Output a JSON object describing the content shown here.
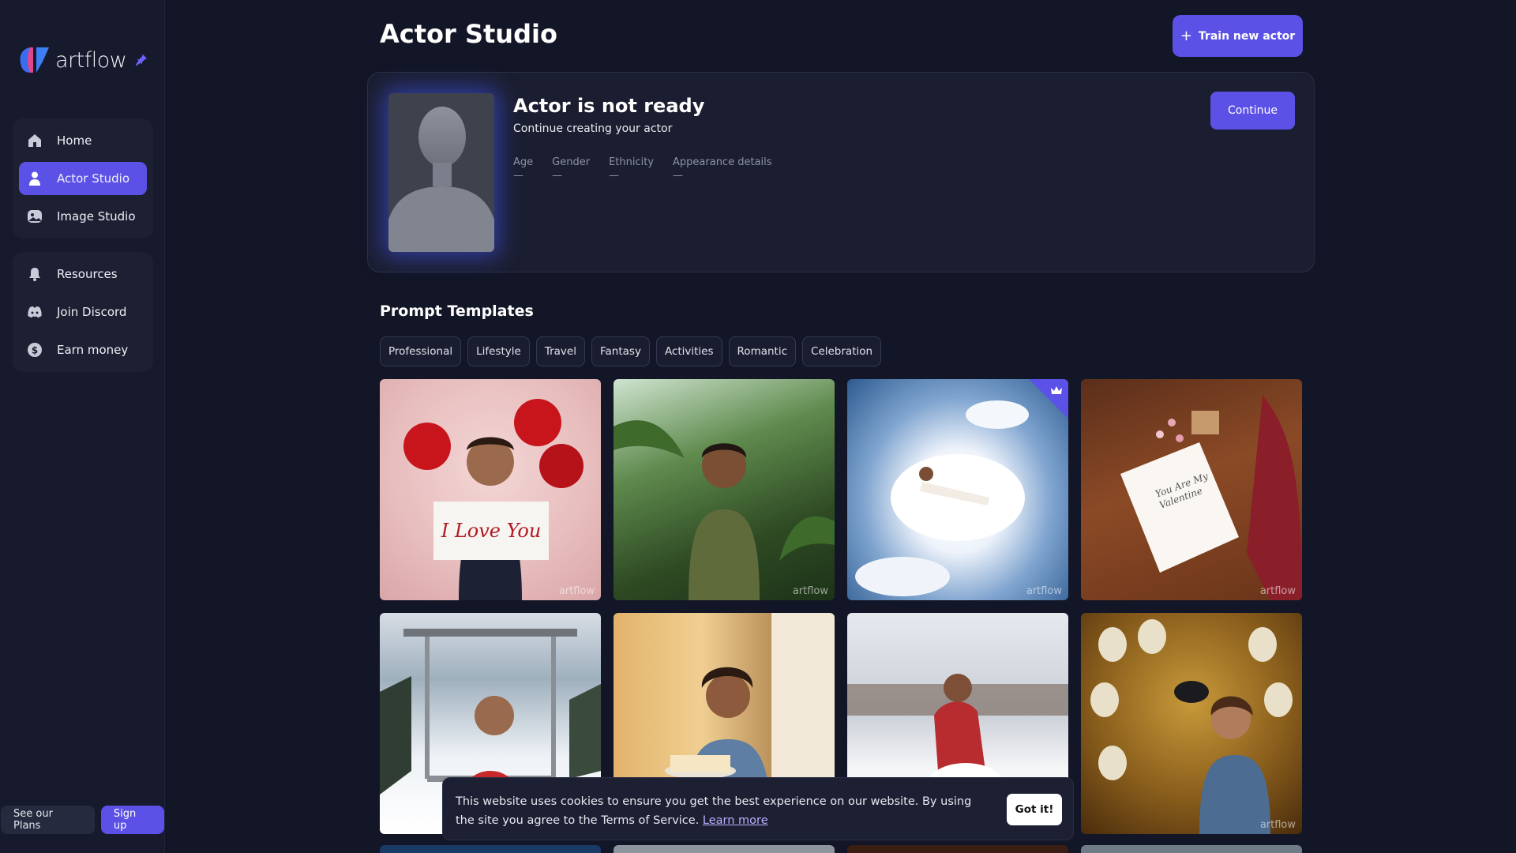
{
  "app": {
    "logo_text": "artflow"
  },
  "sidebar": {
    "group1": [
      {
        "label": "Home",
        "icon": "home-icon",
        "active": false
      },
      {
        "label": "Actor Studio",
        "icon": "person-icon",
        "active": true
      },
      {
        "label": "Image Studio",
        "icon": "image-studio-icon",
        "active": false
      }
    ],
    "group2": [
      {
        "label": "Resources",
        "icon": "bell-icon"
      },
      {
        "label": "Join Discord",
        "icon": "discord-icon"
      },
      {
        "label": "Earn money",
        "icon": "dollar-icon"
      }
    ],
    "plans_label": "See our Plans",
    "signup_label": "Sign up"
  },
  "header": {
    "title": "Actor Studio",
    "train_label": "Train new actor"
  },
  "actor": {
    "title": "Actor is not ready",
    "subtitle": "Continue creating your actor",
    "continue_label": "Continue",
    "fields": [
      {
        "label": "Age",
        "value": "—"
      },
      {
        "label": "Gender",
        "value": "—"
      },
      {
        "label": "Ethnicity",
        "value": "—"
      },
      {
        "label": "Appearance details",
        "value": "—"
      }
    ]
  },
  "templates": {
    "title": "Prompt Templates",
    "chips": [
      "Professional",
      "Lifestyle",
      "Travel",
      "Fantasy",
      "Activities",
      "Romantic",
      "Celebration"
    ],
    "watermark": "artflow",
    "love_sign": "I Love You",
    "card_text": "You Are My Valentine"
  },
  "cookie": {
    "text": "This website uses cookies to ensure you get the best experience on our website. By using the site you agree to the Terms of Service.",
    "link": "Learn more",
    "button": "Got it!"
  },
  "colors": {
    "accent": "#5b51e6",
    "background": "#131626",
    "sidebar": "#171a2c"
  }
}
